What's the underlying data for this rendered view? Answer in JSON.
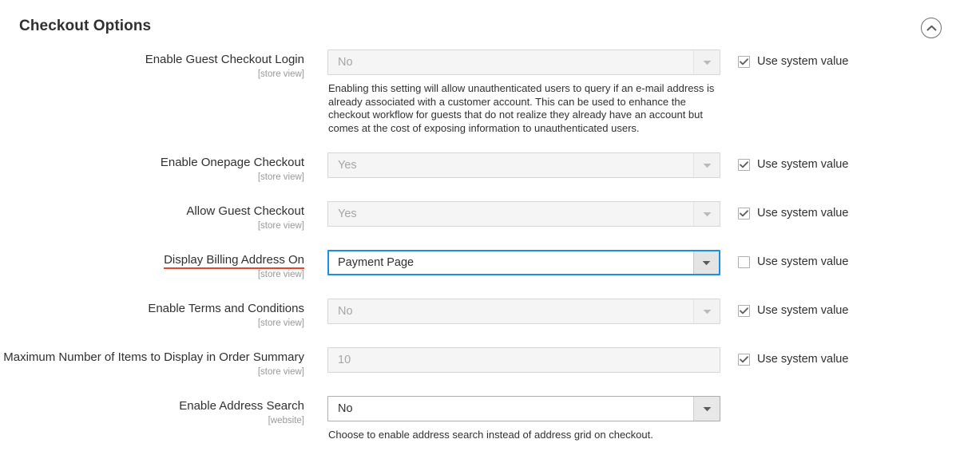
{
  "section": {
    "title": "Checkout Options",
    "collapse_icon": "chevron-up-circle-icon"
  },
  "common": {
    "use_system_value_label": "Use system value",
    "scope_store_view": "[store view]",
    "scope_website": "[website]",
    "dropdown_icon": "chevron-down-icon",
    "check_icon": "check-icon"
  },
  "colors": {
    "focus_border": "#1a8fe3",
    "changed_underline": "#e8462b",
    "disabled_bg": "#f5f5f5",
    "text": "#303030",
    "muted_text": "#a6a6a6",
    "scope_text": "#999999"
  },
  "fields": [
    {
      "id": "enable-guest-checkout-login",
      "label": "Enable Guest Checkout Login",
      "scope": "[store view]",
      "control": "select",
      "value": "No",
      "state": "disabled",
      "use_system_value": true,
      "use_system_value_label": "Use system value",
      "note": "Enabling this setting will allow unauthenticated users to query if an e-mail address is already associated with a customer account. This can be used to enhance the checkout workflow for guests that do not realize they already have an account but comes at the cost of exposing information to unauthenticated users."
    },
    {
      "id": "enable-onepage-checkout",
      "label": "Enable Onepage Checkout",
      "scope": "[store view]",
      "control": "select",
      "value": "Yes",
      "state": "disabled",
      "use_system_value": true,
      "use_system_value_label": "Use system value",
      "note": ""
    },
    {
      "id": "allow-guest-checkout",
      "label": "Allow Guest Checkout",
      "scope": "[store view]",
      "control": "select",
      "value": "Yes",
      "state": "disabled",
      "use_system_value": true,
      "use_system_value_label": "Use system value",
      "note": ""
    },
    {
      "id": "display-billing-address-on",
      "label": "Display Billing Address On",
      "scope": "[store view]",
      "control": "select",
      "value": "Payment Page",
      "state": "focused",
      "changed": true,
      "use_system_value": false,
      "use_system_value_label": "Use system value",
      "note": ""
    },
    {
      "id": "enable-terms-and-conditions",
      "label": "Enable Terms and Conditions",
      "scope": "[store view]",
      "control": "select",
      "value": "No",
      "state": "disabled",
      "use_system_value": true,
      "use_system_value_label": "Use system value",
      "note": ""
    },
    {
      "id": "maximum-number-of-items-to-display-in-order-summary",
      "label": "Maximum Number of Items to Display in Order Summary",
      "scope": "[store view]",
      "control": "text",
      "value": "10",
      "state": "disabled",
      "use_system_value": true,
      "use_system_value_label": "Use system value",
      "note": ""
    },
    {
      "id": "enable-address-search",
      "label": "Enable Address Search",
      "scope": "[website]",
      "control": "select",
      "value": "No",
      "state": "enabled",
      "use_system_value": null,
      "note": "Choose to enable address search instead of address grid on checkout."
    }
  ]
}
